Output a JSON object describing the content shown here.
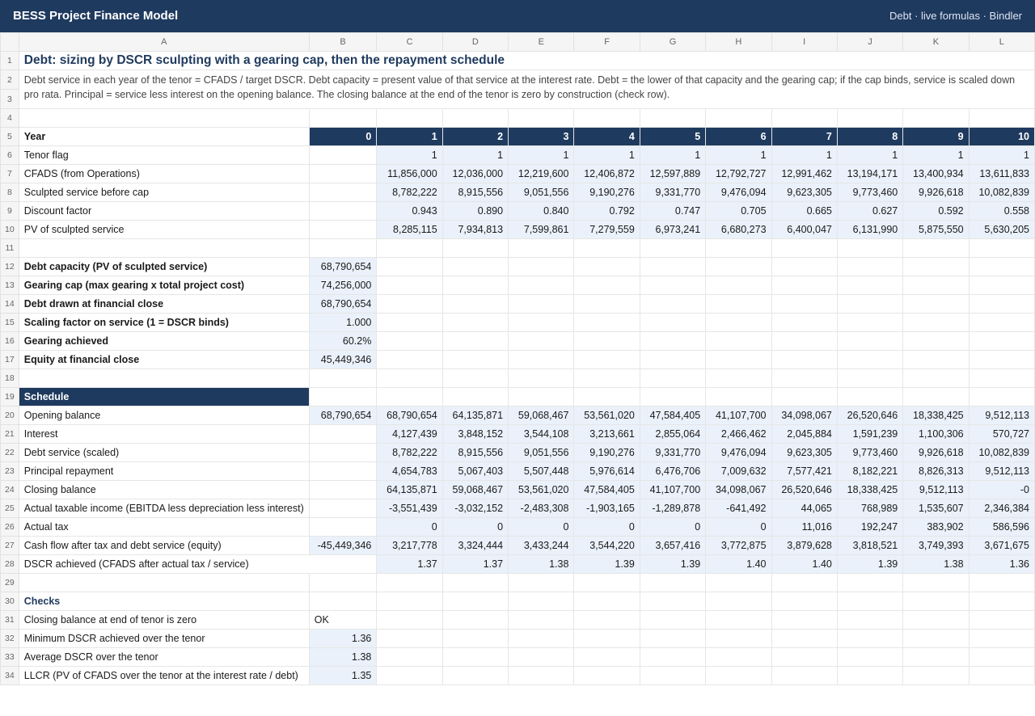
{
  "app": {
    "title": "BESS Project Finance Model",
    "status": "Debt · live formulas · Bindler"
  },
  "columns": [
    "A",
    "B",
    "C",
    "D",
    "E",
    "F",
    "G",
    "H",
    "I",
    "J",
    "K",
    "L"
  ],
  "sheet": {
    "title": "Debt: sizing by DSCR sculpting with a gearing cap, then the repayment schedule",
    "note": "Debt service in each year of the tenor = CFADS / target DSCR. Debt capacity = present value of that service at the interest rate. Debt = the lower of that capacity and the gearing cap; if the cap binds, service is scaled down pro rata. Principal = service less interest on the opening balance. The closing balance at the end of the tenor is zero by construction (check row).",
    "year_label": "Year",
    "years": [
      "0",
      "1",
      "2",
      "3",
      "4",
      "5",
      "6",
      "7",
      "8",
      "9",
      "10"
    ],
    "sizing_rows": [
      {
        "label": "Tenor flag",
        "b": "",
        "v": [
          "1",
          "1",
          "1",
          "1",
          "1",
          "1",
          "1",
          "1",
          "1",
          "1"
        ]
      },
      {
        "label": "CFADS (from Operations)",
        "b": "",
        "v": [
          "11,856,000",
          "12,036,000",
          "12,219,600",
          "12,406,872",
          "12,597,889",
          "12,792,727",
          "12,991,462",
          "13,194,171",
          "13,400,934",
          "13,611,833"
        ]
      },
      {
        "label": "Sculpted service before cap",
        "b": "",
        "v": [
          "8,782,222",
          "8,915,556",
          "9,051,556",
          "9,190,276",
          "9,331,770",
          "9,476,094",
          "9,623,305",
          "9,773,460",
          "9,926,618",
          "10,082,839"
        ]
      },
      {
        "label": "Discount factor",
        "b": "",
        "v": [
          "0.943",
          "0.890",
          "0.840",
          "0.792",
          "0.747",
          "0.705",
          "0.665",
          "0.627",
          "0.592",
          "0.558"
        ]
      },
      {
        "label": "PV of sculpted service",
        "b": "",
        "v": [
          "8,285,115",
          "7,934,813",
          "7,599,861",
          "7,279,559",
          "6,973,241",
          "6,680,273",
          "6,400,047",
          "6,131,990",
          "5,875,550",
          "5,630,205"
        ]
      }
    ],
    "summary": [
      {
        "label": "Debt capacity (PV of sculpted service)",
        "value": "68,790,654"
      },
      {
        "label": "Gearing cap (max gearing x total project cost)",
        "value": "74,256,000"
      },
      {
        "label": "Debt drawn at financial close",
        "value": "68,790,654"
      },
      {
        "label": "Scaling factor on service (1 = DSCR binds)",
        "value": "1.000"
      },
      {
        "label": "Gearing achieved",
        "value": "60.2%"
      },
      {
        "label": "Equity at financial close",
        "value": "45,449,346"
      }
    ],
    "schedule_header": "Schedule",
    "schedule_rows": [
      {
        "label": "Opening balance",
        "b": "68,790,654",
        "v": [
          "68,790,654",
          "64,135,871",
          "59,068,467",
          "53,561,020",
          "47,584,405",
          "41,107,700",
          "34,098,067",
          "26,520,646",
          "18,338,425",
          "9,512,113"
        ]
      },
      {
        "label": "Interest",
        "b": "",
        "v": [
          "4,127,439",
          "3,848,152",
          "3,544,108",
          "3,213,661",
          "2,855,064",
          "2,466,462",
          "2,045,884",
          "1,591,239",
          "1,100,306",
          "570,727"
        ]
      },
      {
        "label": "Debt service (scaled)",
        "b": "",
        "v": [
          "8,782,222",
          "8,915,556",
          "9,051,556",
          "9,190,276",
          "9,331,770",
          "9,476,094",
          "9,623,305",
          "9,773,460",
          "9,926,618",
          "10,082,839"
        ]
      },
      {
        "label": "Principal repayment",
        "b": "",
        "v": [
          "4,654,783",
          "5,067,403",
          "5,507,448",
          "5,976,614",
          "6,476,706",
          "7,009,632",
          "7,577,421",
          "8,182,221",
          "8,826,313",
          "9,512,113"
        ]
      },
      {
        "label": "Closing balance",
        "b": "",
        "v": [
          "64,135,871",
          "59,068,467",
          "53,561,020",
          "47,584,405",
          "41,107,700",
          "34,098,067",
          "26,520,646",
          "18,338,425",
          "9,512,113",
          "-0"
        ]
      },
      {
        "label": "Actual taxable income (EBITDA less depreciation less interest)",
        "b": "",
        "v": [
          "-3,551,439",
          "-3,032,152",
          "-2,483,308",
          "-1,903,165",
          "-1,289,878",
          "-641,492",
          "44,065",
          "768,989",
          "1,535,607",
          "2,346,384"
        ]
      },
      {
        "label": "Actual tax",
        "b": "",
        "v": [
          "0",
          "0",
          "0",
          "0",
          "0",
          "0",
          "11,016",
          "192,247",
          "383,902",
          "586,596"
        ]
      },
      {
        "label": "Cash flow after tax and debt service (equity)",
        "b": "-45,449,346",
        "v": [
          "3,217,778",
          "3,324,444",
          "3,433,244",
          "3,544,220",
          "3,657,416",
          "3,772,875",
          "3,879,628",
          "3,818,521",
          "3,749,393",
          "3,671,675"
        ]
      },
      {
        "label": "DSCR achieved (CFADS after actual tax / service)",
        "b": "",
        "v": [
          "1.37",
          "1.37",
          "1.38",
          "1.39",
          "1.39",
          "1.40",
          "1.40",
          "1.39",
          "1.38",
          "1.36"
        ]
      }
    ],
    "checks_header": "Checks",
    "checks": [
      {
        "label": "Closing balance at end of tenor is zero",
        "value": "OK"
      },
      {
        "label": "Minimum DSCR achieved over the tenor",
        "value": "1.36"
      },
      {
        "label": "Average DSCR over the tenor",
        "value": "1.38"
      },
      {
        "label": "LLCR (PV of CFADS over the tenor at the interest rate / debt)",
        "value": "1.35"
      }
    ]
  }
}
